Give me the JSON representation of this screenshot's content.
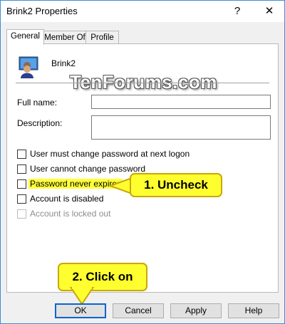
{
  "window": {
    "title": "Brink2 Properties",
    "help_glyph": "?",
    "close_glyph": "✕"
  },
  "tabs": [
    {
      "label": "General",
      "active": true
    },
    {
      "label": "Member Of",
      "active": false
    },
    {
      "label": "Profile",
      "active": false
    }
  ],
  "general": {
    "username": "Brink2",
    "full_name_label": "Full name:",
    "full_name_value": "",
    "description_label": "Description:",
    "description_value": "",
    "checkboxes": [
      {
        "label": "User must change password at next logon",
        "checked": false,
        "enabled": true
      },
      {
        "label": "User cannot change password",
        "checked": false,
        "enabled": true
      },
      {
        "label": "Password never expires",
        "checked": false,
        "enabled": true,
        "highlighted": true
      },
      {
        "label": "Account is disabled",
        "checked": false,
        "enabled": true
      },
      {
        "label": "Account is locked out",
        "checked": false,
        "enabled": false
      }
    ]
  },
  "watermark": "TenForums.com",
  "callouts": {
    "step1": "1. Uncheck",
    "step2": "2. Click on",
    "color": "#ffff30"
  },
  "buttons": {
    "ok": "OK",
    "cancel": "Cancel",
    "apply": "Apply",
    "help": "Help"
  },
  "colors": {
    "accent": "#0a64d0",
    "highlight": "#ffff3a"
  }
}
